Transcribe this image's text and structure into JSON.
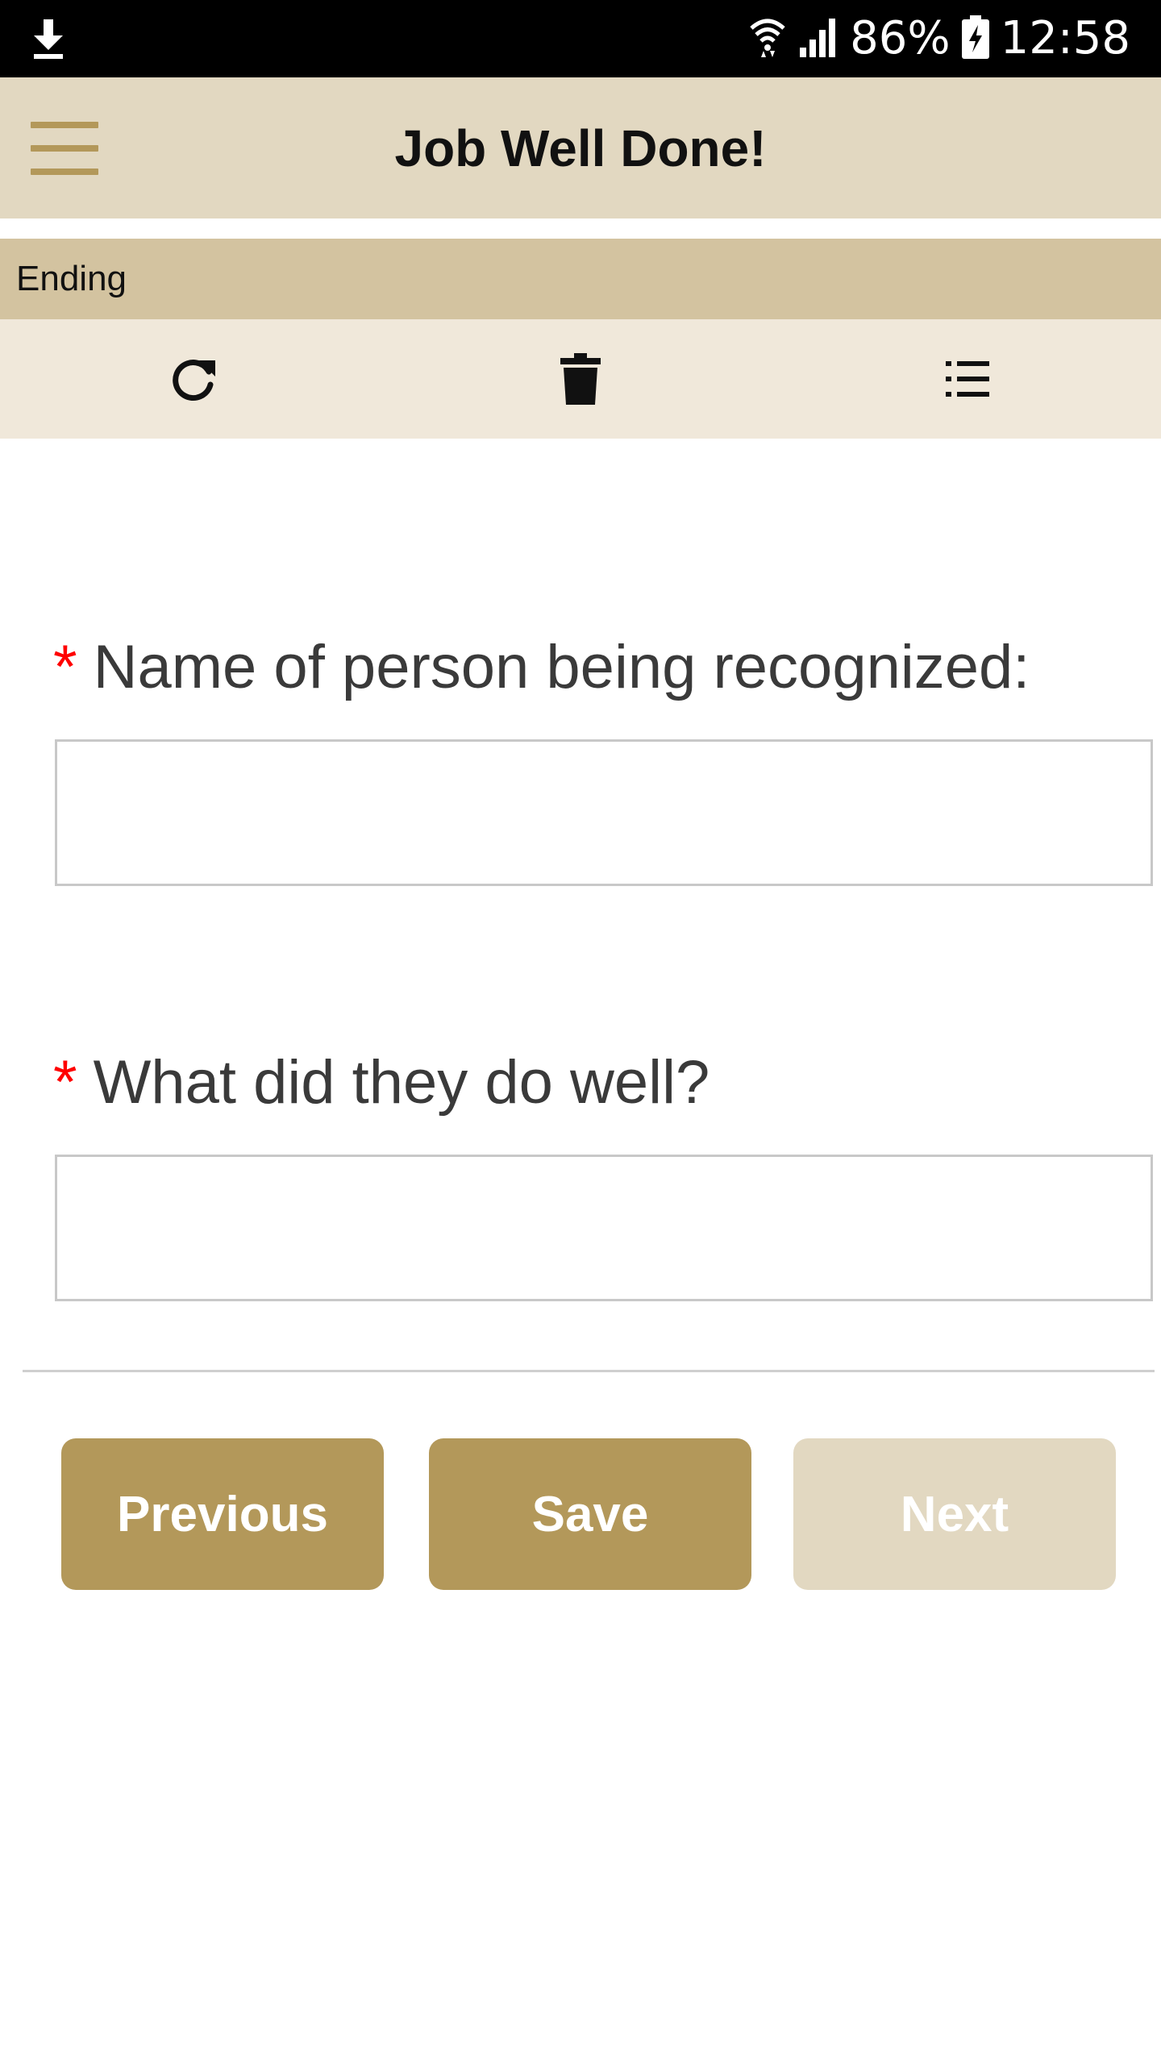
{
  "status_bar": {
    "battery": "86%",
    "time": "12:58",
    "icons": [
      "download-icon",
      "wifi-icon",
      "signal-icon",
      "battery-charging-icon"
    ]
  },
  "app_bar": {
    "title": "Job Well Done!",
    "menu_icon": "hamburger-menu-icon"
  },
  "section": {
    "label": "Ending"
  },
  "toolbar": {
    "icons": [
      "refresh-icon",
      "trash-icon",
      "list-icon"
    ]
  },
  "form": {
    "required_mark": "*",
    "fields": [
      {
        "label": "Name of person being recognized:",
        "value": "",
        "placeholder": ""
      },
      {
        "label": "What did they do well?",
        "value": "",
        "placeholder": ""
      }
    ]
  },
  "buttons": {
    "previous": "Previous",
    "save": "Save",
    "next": "Next"
  },
  "colors": {
    "accent": "#b3985a",
    "app_bar_bg": "#e2d8c1",
    "section_bg": "#d3c3a0",
    "toolbar_bg": "#f0e8da",
    "required": "#ff0000",
    "disabled_button": "#e2d8c1"
  }
}
